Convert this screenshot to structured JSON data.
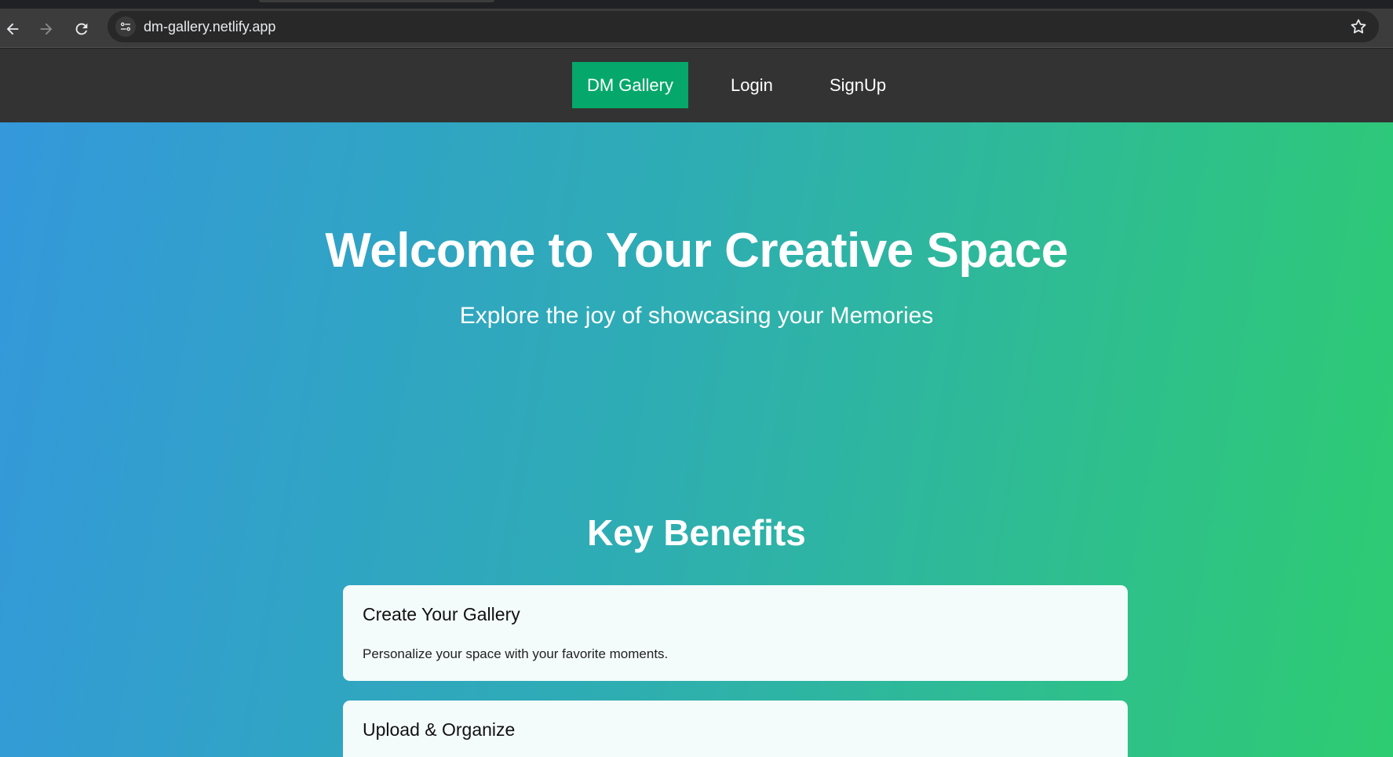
{
  "browser": {
    "url": "dm-gallery.netlify.app",
    "icons": [
      "back-arrow-icon",
      "forward-arrow-icon",
      "reload-icon",
      "site-info-icon",
      "bookmark-star-icon"
    ]
  },
  "navbar": {
    "brand": "DM Gallery",
    "links": [
      "Login",
      "SignUp"
    ],
    "brand_color": "#05a86a",
    "bg_color": "#333333"
  },
  "hero": {
    "title": "Welcome to Your Creative Space",
    "subtitle": "Explore the joy of showcasing your Memories",
    "gradient": [
      "#3498db",
      "#2ecc71"
    ]
  },
  "benefits": {
    "heading": "Key Benefits",
    "items": [
      {
        "title": "Create Your Gallery",
        "description": "Personalize your space with your favorite moments."
      },
      {
        "title": "Upload & Organize",
        "description": ""
      }
    ]
  }
}
